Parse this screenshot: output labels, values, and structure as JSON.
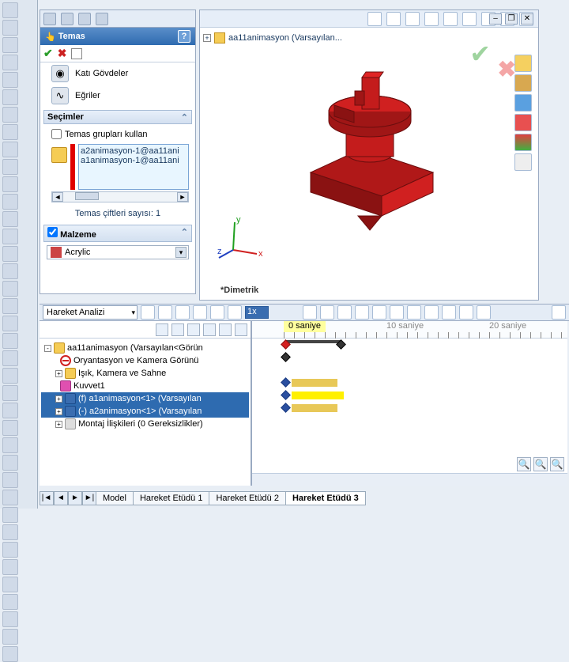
{
  "panel": {
    "title": "Temas",
    "types": {
      "solid_bodies": "Katı Gövdeler",
      "curves": "Eğriler"
    },
    "sections": {
      "selections": "Seçimler",
      "material": "Malzeme"
    },
    "use_groups_label": "Temas grupları kullan",
    "selection_items": [
      "a2animasyon-1@aa11ani",
      "a1animasyon-1@aa11ani"
    ],
    "pair_count_label": "Temas çiftleri sayısı: 1",
    "material_value": "Acrylic"
  },
  "viewport": {
    "assembly_name": "aa11animasyon  (Varsayılan...",
    "view_label": "*Dimetrik",
    "axes": {
      "x": "x",
      "y": "y",
      "z": "z"
    }
  },
  "motion": {
    "study_type": "Hareket Analizi",
    "speed_value": "1x",
    "time_labels": {
      "zero": "0 saniye",
      "ten": "10 saniye",
      "twenty": "20 saniye"
    }
  },
  "tree": {
    "root": "aa11animasyon  (Varsayılan<Görün",
    "items": [
      "Oryantasyon ve Kamera Görünü",
      "Işık, Kamera ve Sahne",
      "Kuvvet1",
      "(f) a1animasyon<1> (Varsayılan",
      "(-) a2animasyon<1> (Varsayılan",
      "Montaj İlişkileri (0 Gereksizlikler)"
    ]
  },
  "tabs": {
    "model": "Model",
    "study1": "Hareket Etüdü 1",
    "study2": "Hareket Etüdü 2",
    "study3": "Hareket Etüdü 3"
  }
}
